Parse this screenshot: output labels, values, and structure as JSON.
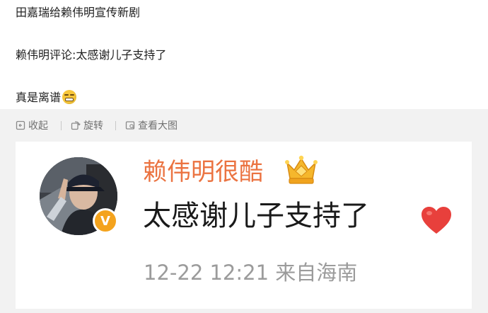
{
  "post": {
    "line1": "田嘉瑞给赖伟明宣传新剧",
    "line2": "赖伟明评论:太感谢儿子支持了",
    "line3": "真是离谱",
    "line3_emoji": "grimace-emoji"
  },
  "toolbar": {
    "collapse_label": "收起",
    "collapse_icon": "collapse-icon",
    "rotate_label": "旋转",
    "rotate_icon": "rotate-icon",
    "full_label": "查看大图",
    "full_icon": "image-view-icon"
  },
  "screenshot_card": {
    "username": "赖伟明很酷",
    "username_color": "#eb7341",
    "crown_icon": "gold-crown-icon",
    "verified_badge": "V",
    "verified_color": "#f4a31d",
    "comment": "太感谢儿子支持了",
    "comment_emoji": "red-heart-icon",
    "timestamp": "12-22 12:21",
    "location": "来自海南"
  }
}
